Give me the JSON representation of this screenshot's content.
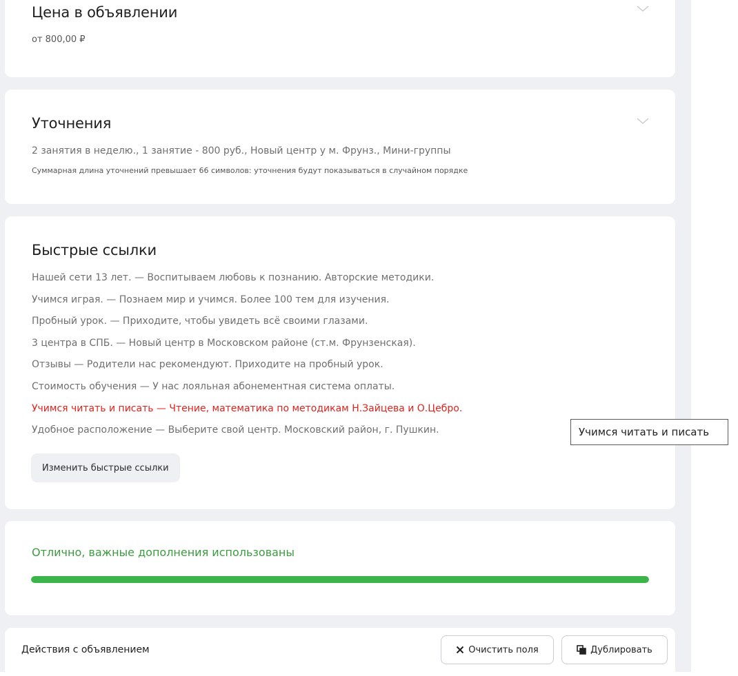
{
  "price_card": {
    "title": "Цена в объявлении",
    "value": "от 800,00 ₽",
    "expand_icon": "chevron-down-icon"
  },
  "clarifications_card": {
    "title": "Уточнения",
    "value": "2 занятия в неделю., 1 занятие - 800 руб., Новый центр у м. Фрунз., Мини-группы",
    "note": "Суммарная длина уточнений превышает 66 символов: уточнения будут показываться в случайном порядке",
    "expand_icon": "chevron-down-icon"
  },
  "quick_links_card": {
    "title": "Быстрые ссылки",
    "items": [
      {
        "label": "Нашей сети 13 лет. — Воспитываем любовь к познанию. Авторские методики.",
        "active": false
      },
      {
        "label": "Учимся играя. — Познаем мир и учимся. Более 100 тем для изучения.",
        "active": false
      },
      {
        "label": "Пробный урок. — Приходите, чтобы увидеть всё своими глазами.",
        "active": false
      },
      {
        "label": "3 центра в СПБ. — Новый центр в Московском районе (ст.м. Фрунзенская).",
        "active": false
      },
      {
        "label": "Отзывы — Родители нас рекомендуют. Приходите на пробный урок.",
        "active": false
      },
      {
        "label": "Стоимость обучения — У нас лояльная абонементная система оплаты.",
        "active": false
      },
      {
        "label": "Учимся читать и писать — Чтение, математика по методикам Н.Зайцева и О.Цебро.",
        "active": true
      },
      {
        "label": "Удобное расположение — Выберите свой центр. Московский район, г. Пушкин.",
        "active": false
      }
    ],
    "edit_button": "Изменить быстрые ссылки"
  },
  "tooltip": {
    "text": "Учимся читать и писать"
  },
  "progress_card": {
    "message": "Отлично, важные дополнения использованы",
    "progress_percent": 100,
    "color": "#3bb54a",
    "text_color": "#3b9c3f"
  },
  "actions_bar": {
    "title": "Действия с объявлением",
    "clear_button": "Очистить поля",
    "clear_icon": "close-icon",
    "duplicate_button": "Дублировать",
    "duplicate_icon": "copy-icon"
  },
  "colors": {
    "page_bg": "#eef0f4",
    "card_bg": "#ffffff",
    "accent_red": "#e3211b",
    "muted_text": "#6f6f6f"
  }
}
